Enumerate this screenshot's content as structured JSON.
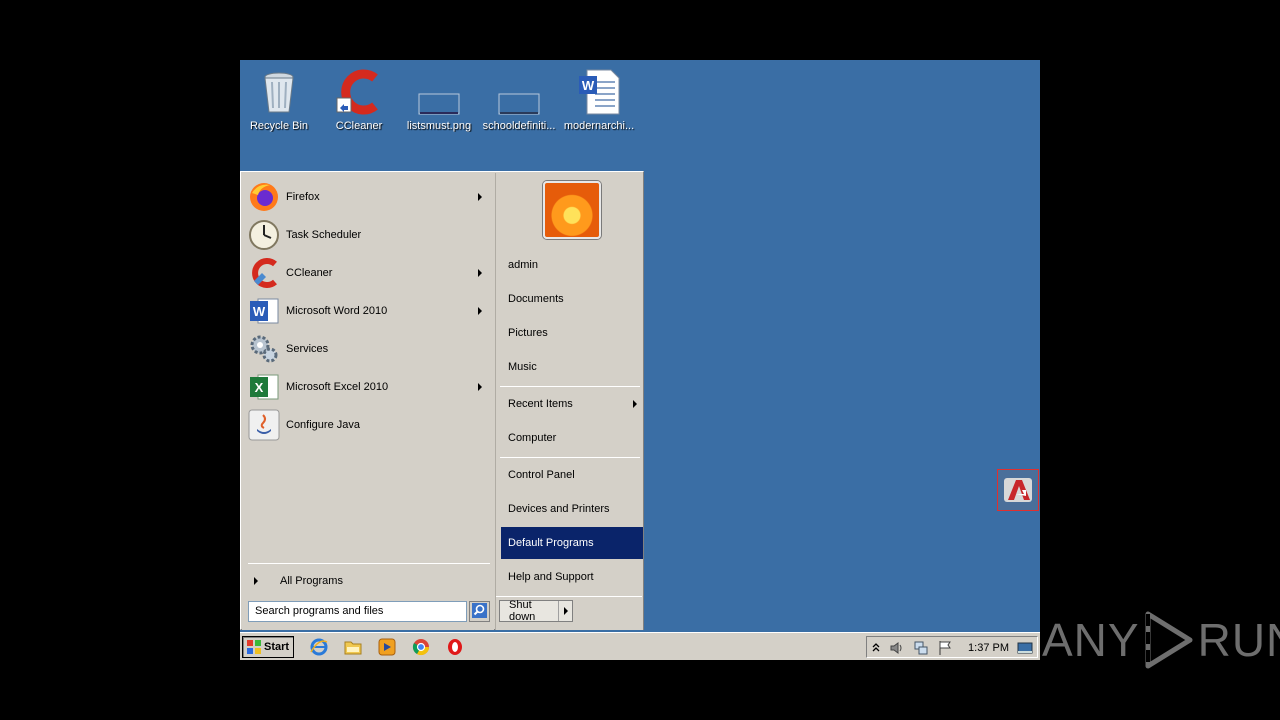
{
  "desktop": {
    "icons": [
      {
        "label": "Recycle Bin",
        "icon": "recycle-bin-icon"
      },
      {
        "label": "CCleaner",
        "icon": "ccleaner-icon"
      },
      {
        "label": "listsmust.png",
        "icon": "image-file-icon"
      },
      {
        "label": "schooldefiniti...",
        "icon": "image-file-icon"
      },
      {
        "label": "modernarchi...",
        "icon": "word-document-icon"
      }
    ]
  },
  "start_menu": {
    "programs": [
      {
        "label": "Firefox",
        "icon": "firefox-icon",
        "submenu": true
      },
      {
        "label": "Task Scheduler",
        "icon": "clock-icon",
        "submenu": false
      },
      {
        "label": "CCleaner",
        "icon": "ccleaner-icon",
        "submenu": true
      },
      {
        "label": "Microsoft Word 2010",
        "icon": "word-icon",
        "submenu": true
      },
      {
        "label": "Services",
        "icon": "gears-icon",
        "submenu": false
      },
      {
        "label": "Microsoft Excel 2010",
        "icon": "excel-icon",
        "submenu": true
      },
      {
        "label": "Configure Java",
        "icon": "java-icon",
        "submenu": false
      }
    ],
    "all_programs_label": "All Programs",
    "search_placeholder": "Search programs and files",
    "right_items": [
      {
        "label": "admin"
      },
      {
        "label": "Documents"
      },
      {
        "label": "Pictures"
      },
      {
        "label": "Music"
      },
      {
        "label": "Recent Items",
        "submenu": true
      },
      {
        "label": "Computer"
      },
      {
        "label": "Control Panel"
      },
      {
        "label": "Devices and Printers"
      },
      {
        "label": "Default Programs",
        "highlighted": true
      },
      {
        "label": "Help and Support"
      }
    ],
    "shutdown_label": "Shut down"
  },
  "taskbar": {
    "start_label": "Start",
    "quick_launch": [
      "internet-explorer-icon",
      "folder-icon",
      "media-player-icon",
      "chrome-icon",
      "opera-icon"
    ],
    "tray_icons": [
      "show-hidden-icon",
      "volume-icon",
      "network-icon",
      "flag-icon"
    ],
    "clock": "1:37 PM"
  },
  "watermark": {
    "text_left": "ANY",
    "text_right": "RUN"
  },
  "colors": {
    "desktop": "#3a6ea5",
    "menu_bg": "#d4d0c8",
    "highlight": "#0a246a"
  }
}
